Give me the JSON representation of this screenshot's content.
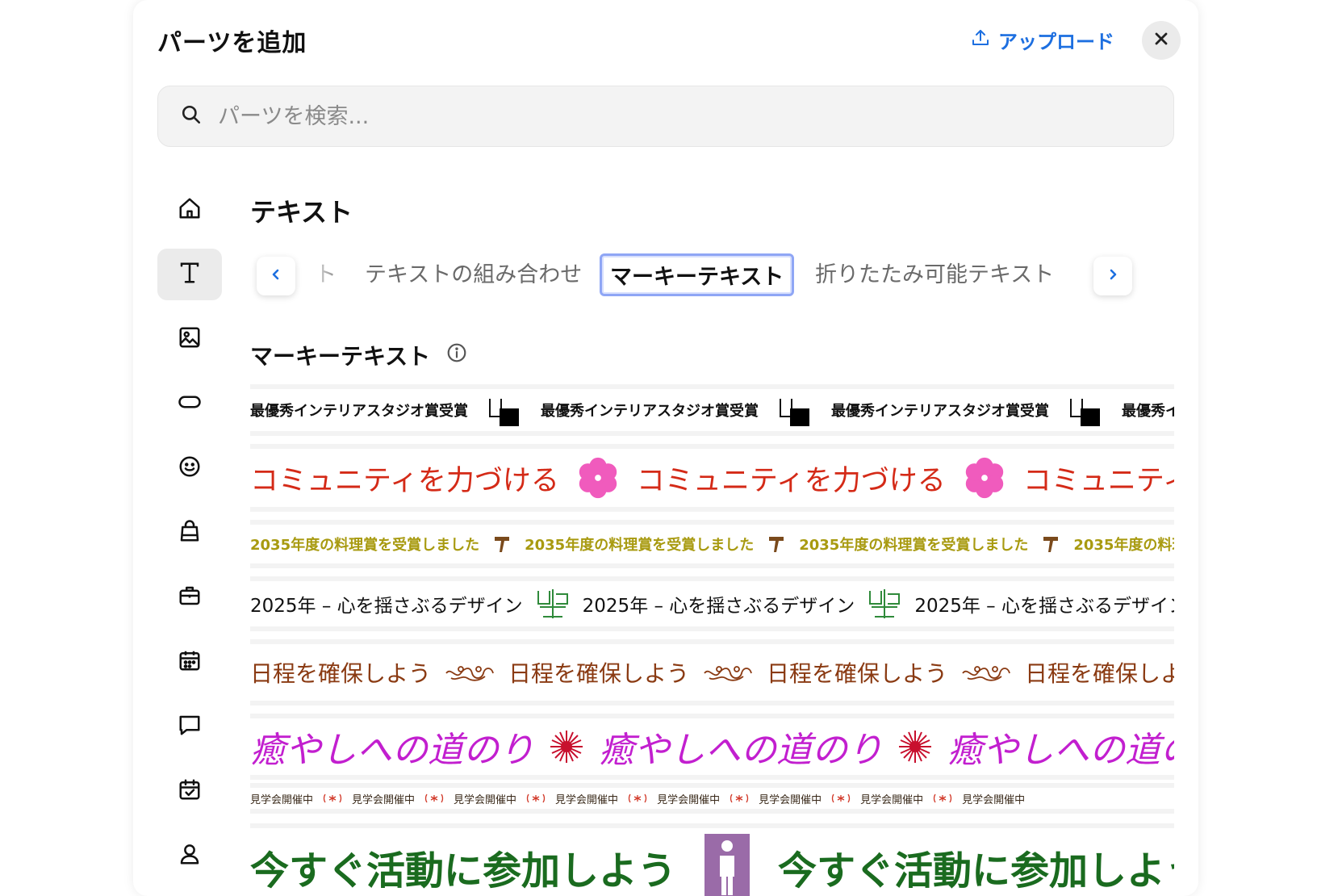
{
  "header": {
    "title": "パーツを追加",
    "upload_label": "アップロード"
  },
  "search": {
    "placeholder": "パーツを検索..."
  },
  "sidebar": {
    "items": [
      {
        "name": "home-icon",
        "active": false
      },
      {
        "name": "text-icon",
        "active": true
      },
      {
        "name": "image-icon",
        "active": false
      },
      {
        "name": "button-icon",
        "active": false
      },
      {
        "name": "smiley-icon",
        "active": false
      },
      {
        "name": "bag-icon",
        "active": false
      },
      {
        "name": "briefcase-icon",
        "active": false
      },
      {
        "name": "calendar-icon",
        "active": false
      },
      {
        "name": "chat-icon",
        "active": false
      },
      {
        "name": "calendar-check-icon",
        "active": false
      },
      {
        "name": "person-icon",
        "active": false
      }
    ]
  },
  "section": {
    "title": "テキスト"
  },
  "tabs": {
    "items": [
      {
        "label": "ト"
      },
      {
        "label": "テキストの組み合わせ"
      },
      {
        "label": "マーキーテキスト",
        "active": true
      },
      {
        "label": "折りたたみ可能テキスト"
      }
    ]
  },
  "subsection": {
    "title": "マーキーテキスト"
  },
  "marquees": [
    {
      "text": "最優秀インテリアスタジオ賞受賞",
      "color": "#111111",
      "separator": "bracket-square"
    },
    {
      "text": "コミュニティを力づける",
      "color": "#d42a17",
      "separator": "pink-flower"
    },
    {
      "text": "2035年度の料理賞を受賞しました",
      "color": "#a89a10",
      "separator": "brown-t"
    },
    {
      "text": "2025年 – 心を揺さぶるデザイン",
      "color": "#111111",
      "separator": "green-glyph"
    },
    {
      "text": "日程を確保しよう",
      "color": "#8a3a12",
      "separator": "brown-swirl"
    },
    {
      "text": "癒やしへの道のり",
      "color": "#c21fcf",
      "separator": "red-starburst"
    },
    {
      "text": "見学会開催中",
      "color": "#3a2a1a",
      "separator": "red-asterisk"
    },
    {
      "text": "今すぐ活動に参加しよう",
      "color": "#1a6b1f",
      "separator": "purple-figure"
    }
  ]
}
